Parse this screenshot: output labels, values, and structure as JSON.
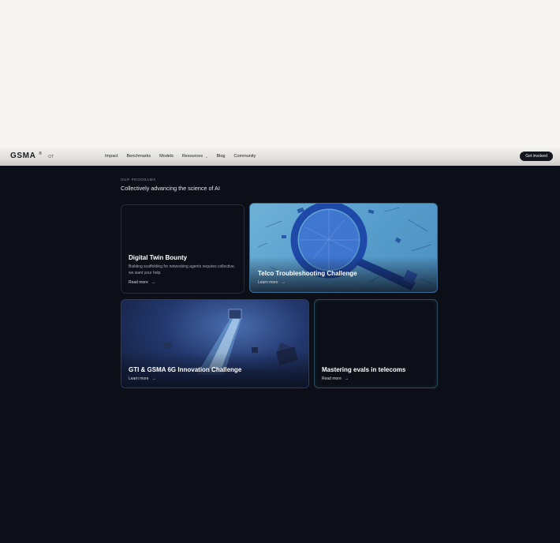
{
  "nav": {
    "logo": "GSMA",
    "logo_tm": "®",
    "logo_sub": "OT",
    "links": [
      "Impact",
      "Benchmarks",
      "Models",
      "Resources",
      "Blog",
      "Community"
    ],
    "cta": "Get involved"
  },
  "programs": {
    "eyebrow": "OUR PROGRAMS",
    "title": "Collectively advancing the science of AI",
    "cards": [
      {
        "title": "Digital Twin Bounty",
        "description": "Building scaffolding for networking agents requires collective, we want your help.",
        "link": "Read more"
      },
      {
        "title": "Telco Troubleshooting Challenge",
        "link": "Learn more"
      },
      {
        "title": "GTI & GSMA 6G Innovation Challenge",
        "link": "Learn more"
      },
      {
        "title": "Mastering evals in telecoms",
        "link": "Read more"
      }
    ]
  },
  "icons": {
    "arrow": "→",
    "chevron": "⌄"
  }
}
